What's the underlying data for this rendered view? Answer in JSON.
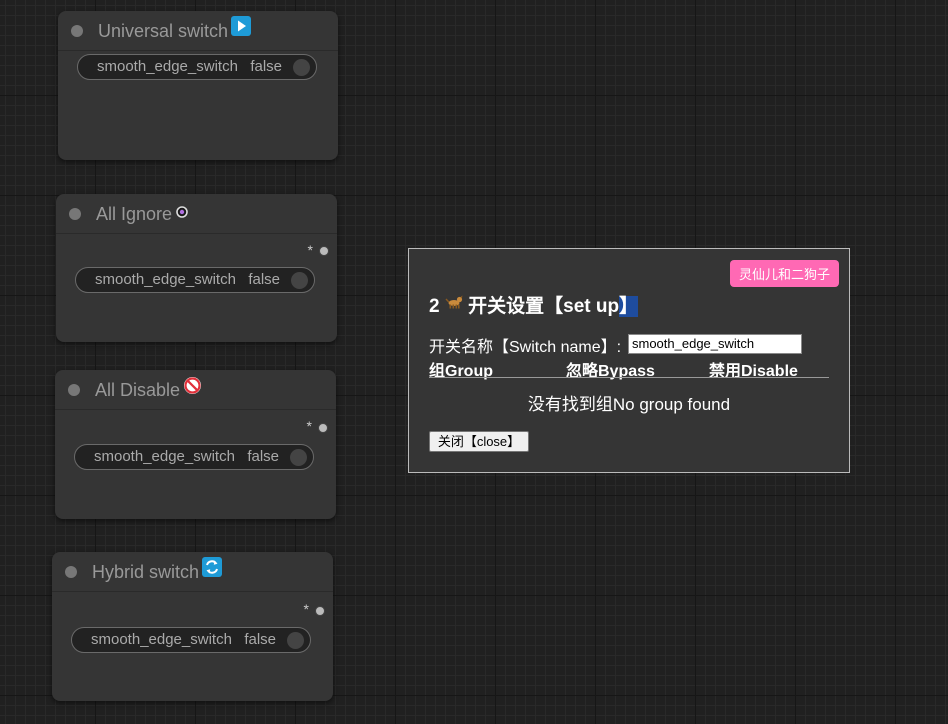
{
  "nodes": [
    {
      "title": "Universal switch",
      "icon": "play-button-icon",
      "widget_name": "smooth_edge_switch",
      "widget_value": "false",
      "output_label": ""
    },
    {
      "title": "All Ignore",
      "icon": "ring-dot-icon",
      "widget_name": "smooth_edge_switch",
      "widget_value": "false",
      "output_label": "*"
    },
    {
      "title": "All Disable",
      "icon": "no-entry-icon",
      "widget_name": "smooth_edge_switch",
      "widget_value": "false",
      "output_label": "*"
    },
    {
      "title": "Hybrid switch",
      "icon": "refresh-arrows-icon",
      "widget_name": "smooth_edge_switch",
      "widget_value": "false",
      "output_label": "*"
    }
  ],
  "dialog": {
    "tag": "灵仙儿和二狗子",
    "title_prefix": "2",
    "title_text": "开关设置【set up",
    "title_suffix": "】",
    "name_label": "开关名称【Switch name】:",
    "name_value": "smooth_edge_switch",
    "columns": [
      "组Group",
      "忽略Bypass",
      "禁用Disable"
    ],
    "empty_text": "没有找到组No group found",
    "close_label": "关闭【close】"
  },
  "colors": {
    "canvas": "#202020",
    "node_bg": "#353535",
    "tag_bg": "#ff69b4",
    "title_highlight": "#1e4c9e"
  }
}
